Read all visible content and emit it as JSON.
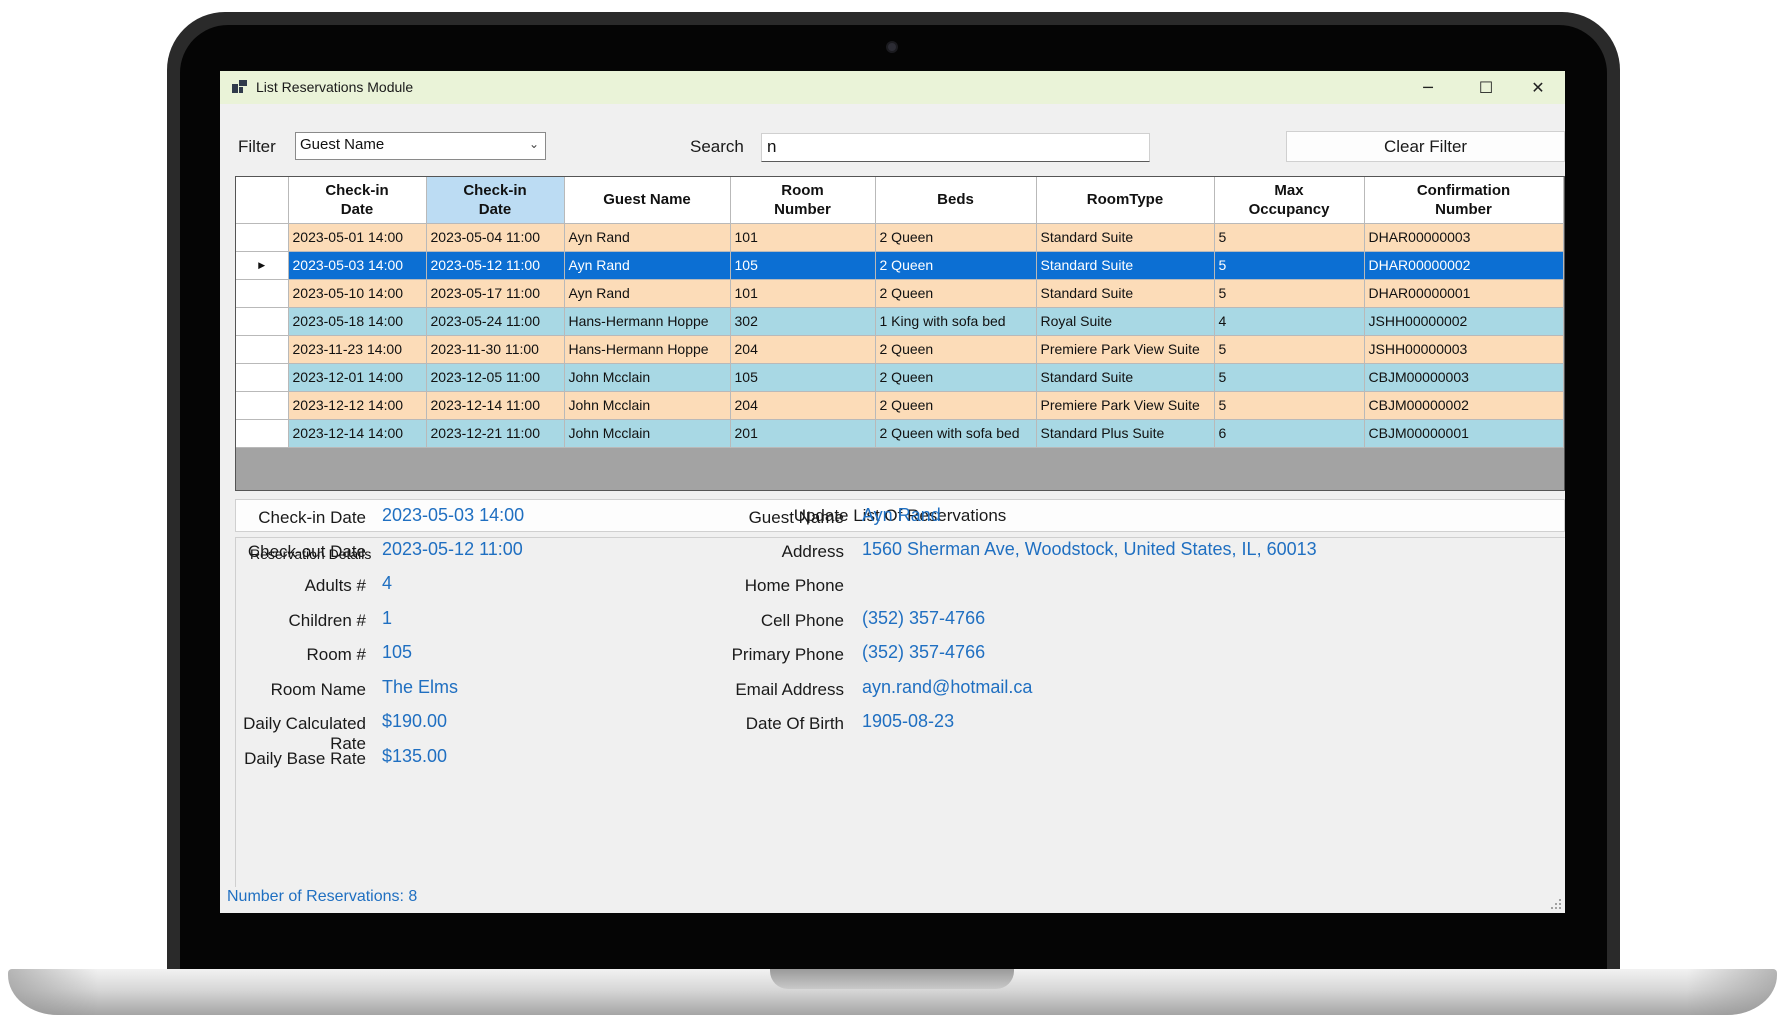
{
  "window": {
    "title": "List Reservations Module",
    "minimize": "─",
    "maximize": "☐",
    "close": "✕"
  },
  "filter": {
    "label": "Filter",
    "selected": "Guest Name",
    "search_label": "Search",
    "search_value": "n",
    "clear_button": "Clear Filter"
  },
  "grid": {
    "columns": [
      "Check-in\nDate",
      "Check-in\nDate",
      "Guest Name",
      "Room\nNumber",
      "Beds",
      "RoomType",
      "Max\nOccupancy",
      "Confirmation\nNumber"
    ],
    "selected_column": 1,
    "current_row_marker": "▶",
    "rows": [
      {
        "checkin": "2023-05-01 14:00",
        "checkout": "2023-05-04 11:00",
        "guest": "Ayn Rand",
        "room": "101",
        "beds": "2 Queen",
        "type": "Standard Suite",
        "max": "5",
        "conf": "DHAR00000003",
        "style": "peach"
      },
      {
        "checkin": "2023-05-03 14:00",
        "checkout": "2023-05-12 11:00",
        "guest": "Ayn Rand",
        "room": "105",
        "beds": "2 Queen",
        "type": "Standard Suite",
        "max": "5",
        "conf": "DHAR00000002",
        "style": "selected"
      },
      {
        "checkin": "2023-05-10 14:00",
        "checkout": "2023-05-17 11:00",
        "guest": "Ayn Rand",
        "room": "101",
        "beds": "2 Queen",
        "type": "Standard Suite",
        "max": "5",
        "conf": "DHAR00000001",
        "style": "peach"
      },
      {
        "checkin": "2023-05-18 14:00",
        "checkout": "2023-05-24 11:00",
        "guest": "Hans-Hermann Hoppe",
        "room": "302",
        "beds": "1 King with sofa bed",
        "type": "Royal Suite",
        "max": "4",
        "conf": "JSHH00000002",
        "style": "blue"
      },
      {
        "checkin": "2023-11-23 14:00",
        "checkout": "2023-11-30 11:00",
        "guest": "Hans-Hermann Hoppe",
        "room": "204",
        "beds": "2 Queen",
        "type": "Premiere Park View Suite",
        "max": "5",
        "conf": "JSHH00000003",
        "style": "peach"
      },
      {
        "checkin": "2023-12-01 14:00",
        "checkout": "2023-12-05 11:00",
        "guest": "John Mcclain",
        "room": "105",
        "beds": "2 Queen",
        "type": "Standard Suite",
        "max": "5",
        "conf": "CBJM00000003",
        "style": "blue"
      },
      {
        "checkin": "2023-12-12 14:00",
        "checkout": "2023-12-14 11:00",
        "guest": "John Mcclain",
        "room": "204",
        "beds": "2 Queen",
        "type": "Premiere Park View Suite",
        "max": "5",
        "conf": "CBJM00000002",
        "style": "peach"
      },
      {
        "checkin": "2023-12-14 14:00",
        "checkout": "2023-12-21 11:00",
        "guest": "John Mcclain",
        "room": "201",
        "beds": "2 Queen with sofa bed",
        "type": "Standard Plus Suite",
        "max": "6",
        "conf": "CBJM00000001",
        "style": "blue"
      }
    ]
  },
  "update_button": "Update List Of Reservations",
  "details": {
    "group_title": "Reservation Details",
    "left": [
      {
        "label": "Check-in Date",
        "value": "2023-05-03 14:00"
      },
      {
        "label": "Check-out Date",
        "value": "2023-05-12 11:00"
      },
      {
        "label": "Adults #",
        "value": "4"
      },
      {
        "label": "Children #",
        "value": "1"
      },
      {
        "label": "Room #",
        "value": "105"
      },
      {
        "label": "Room Name",
        "value": "The Elms"
      },
      {
        "label": "Daily Calculated Rate",
        "value": "$190.00"
      },
      {
        "label": "Daily Base Rate",
        "value": "$135.00"
      }
    ],
    "right": [
      {
        "label": "Guest Name",
        "value": "Ayn Rand"
      },
      {
        "label": "Address",
        "value": "1560 Sherman Ave, Woodstock, United States, IL, 60013"
      },
      {
        "label": "Home Phone",
        "value": ""
      },
      {
        "label": "Cell Phone",
        "value": "(352) 357-4766"
      },
      {
        "label": "Primary Phone",
        "value": "(352) 357-4766"
      },
      {
        "label": "Email Address",
        "value": "ayn.rand@hotmail.ca"
      },
      {
        "label": "Date Of Birth",
        "value": "1905-08-23"
      }
    ]
  },
  "status": "Number of Reservations: 8",
  "colors": {
    "accent": "#1f6fc1",
    "selected_row": "#0c6fd3",
    "peach_row": "#fcdcb8",
    "blue_row": "#a8d8e4",
    "titlebar": "#eaf3d8"
  }
}
